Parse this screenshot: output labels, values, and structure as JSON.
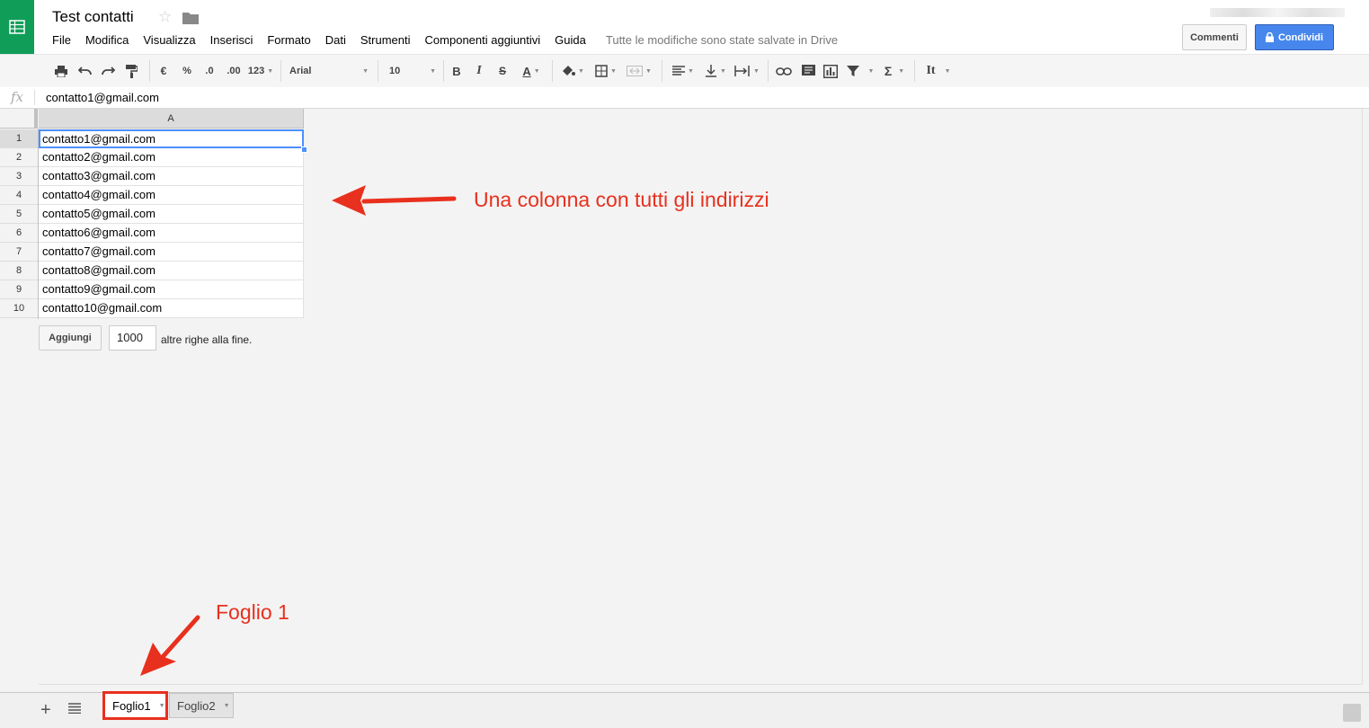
{
  "header": {
    "title": "Test contatti",
    "menu": [
      "File",
      "Modifica",
      "Visualizza",
      "Inserisci",
      "Formato",
      "Dati",
      "Strumenti",
      "Componenti aggiuntivi",
      "Guida"
    ],
    "save_status": "Tutte le modifiche sono state salvate in Drive",
    "comment_button": "Commenti",
    "share_button": "Condividi"
  },
  "toolbar": {
    "currency": "€",
    "percent": "%",
    "decrease_decimals": ".0",
    "increase_decimals": ".00",
    "more_formats": "123",
    "font": "Arial",
    "font_size": "10",
    "bold": "B",
    "italic": "I",
    "strikethrough": "S",
    "text_color": "A",
    "sum": "Σ",
    "input_tools": "It"
  },
  "formula_bar": {
    "fx": "fx",
    "value": "contatto1@gmail.com"
  },
  "grid": {
    "column_header": "A",
    "rows": [
      {
        "num": "1",
        "value": "contatto1@gmail.com"
      },
      {
        "num": "2",
        "value": "contatto2@gmail.com"
      },
      {
        "num": "3",
        "value": "contatto3@gmail.com"
      },
      {
        "num": "4",
        "value": "contatto4@gmail.com"
      },
      {
        "num": "5",
        "value": "contatto5@gmail.com"
      },
      {
        "num": "6",
        "value": "contatto6@gmail.com"
      },
      {
        "num": "7",
        "value": "contatto7@gmail.com"
      },
      {
        "num": "8",
        "value": "contatto8@gmail.com"
      },
      {
        "num": "9",
        "value": "contatto9@gmail.com"
      },
      {
        "num": "10",
        "value": "contatto10@gmail.com"
      }
    ],
    "add_button": "Aggiungi",
    "add_count": "1000",
    "add_suffix": "altre righe alla fine."
  },
  "annotations": {
    "column_note": "Una colonna con tutti gli indirizzi",
    "sheet_note": "Foglio 1"
  },
  "sheets": [
    "Foglio1",
    "Foglio2"
  ],
  "colors": {
    "brand": "#0f9d58",
    "share": "#4787ed",
    "annotation": "#e8301e",
    "selection": "#4d90fe"
  }
}
